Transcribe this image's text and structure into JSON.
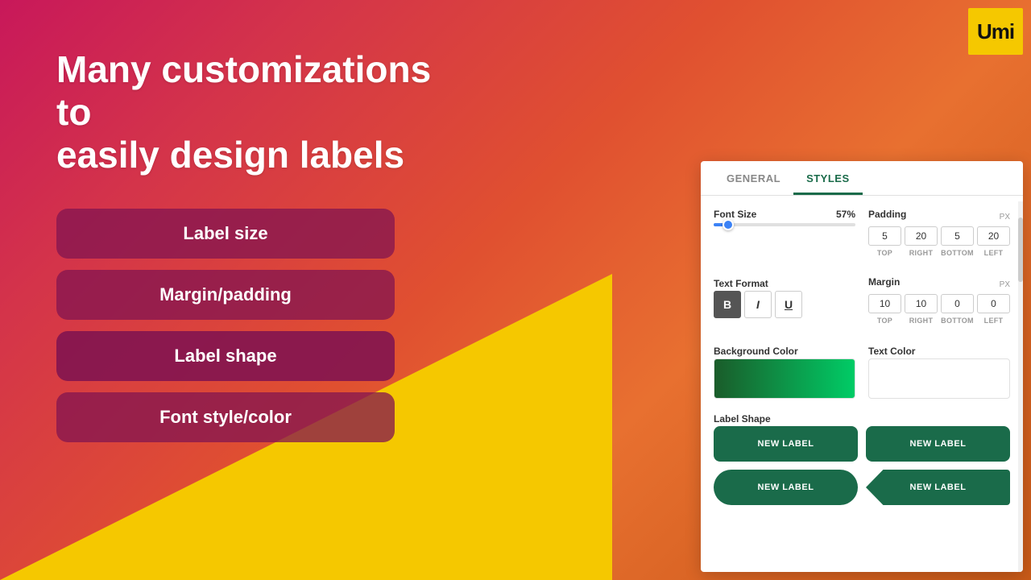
{
  "logo": {
    "text": "Umi"
  },
  "main": {
    "title": "Many customizations to\neasily design labels"
  },
  "features": [
    {
      "id": "label-size",
      "label": "Label size"
    },
    {
      "id": "margin-padding",
      "label": "Margin/padding"
    },
    {
      "id": "label-shape",
      "label": "Label shape"
    },
    {
      "id": "font-style",
      "label": "Font style/color"
    }
  ],
  "panel": {
    "tabs": [
      {
        "id": "general",
        "label": "GENERAL"
      },
      {
        "id": "styles",
        "label": "STYLES",
        "active": true
      }
    ],
    "font_size": {
      "label": "Font Size",
      "value": "57%"
    },
    "padding": {
      "label": "Padding",
      "px": "PX",
      "top": "5",
      "right": "20",
      "bottom": "5",
      "left": "20"
    },
    "text_format": {
      "label": "Text Format",
      "bold": "B",
      "italic": "I",
      "underline": "U"
    },
    "margin": {
      "label": "Margin",
      "px": "PX",
      "top": "10",
      "right": "10",
      "bottom": "0",
      "left": "0"
    },
    "background_color": {
      "label": "Background Color"
    },
    "text_color": {
      "label": "Text Color"
    },
    "label_shape": {
      "label": "Label Shape",
      "buttons": [
        {
          "id": "rounded",
          "text": "NEW LABEL",
          "shape": "rounded"
        },
        {
          "id": "rounded2",
          "text": "NEW LABEL",
          "shape": "rounded"
        },
        {
          "id": "pill",
          "text": "NEW LABEL",
          "shape": "pill"
        },
        {
          "id": "banner",
          "text": "NEW LABEL",
          "shape": "banner"
        }
      ]
    },
    "pad_labels": {
      "top": "TOP",
      "right": "RIGHT",
      "bottom": "BOTTOM",
      "left": "LEFT"
    }
  }
}
